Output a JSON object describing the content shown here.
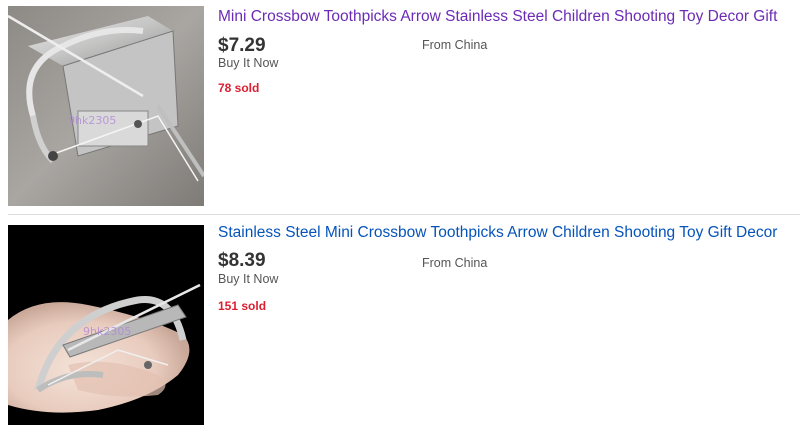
{
  "colors": {
    "visited_link": "#6b2bb5",
    "link": "#0654ba",
    "price": "#333333",
    "muted": "#555555",
    "sold": "#dd1e31",
    "divider": "#dddddd"
  },
  "listings": [
    {
      "title": "Mini Crossbow Toothpicks Arrow Stainless Steel Children Shooting Toy Decor Gift",
      "title_state": "visited",
      "price": "$7.29",
      "format": "Buy It Now",
      "location": "From China",
      "sold": "78 sold",
      "image_icon": "crossbow-product-photo"
    },
    {
      "title": "Stainless Steel Mini Crossbow Toothpicks Arrow Children Shooting Toy Gift Decor",
      "title_state": "unvisited",
      "price": "$8.39",
      "format": "Buy It Now",
      "location": "From China",
      "sold": "151 sold",
      "image_icon": "crossbow-in-hand-photo"
    }
  ]
}
